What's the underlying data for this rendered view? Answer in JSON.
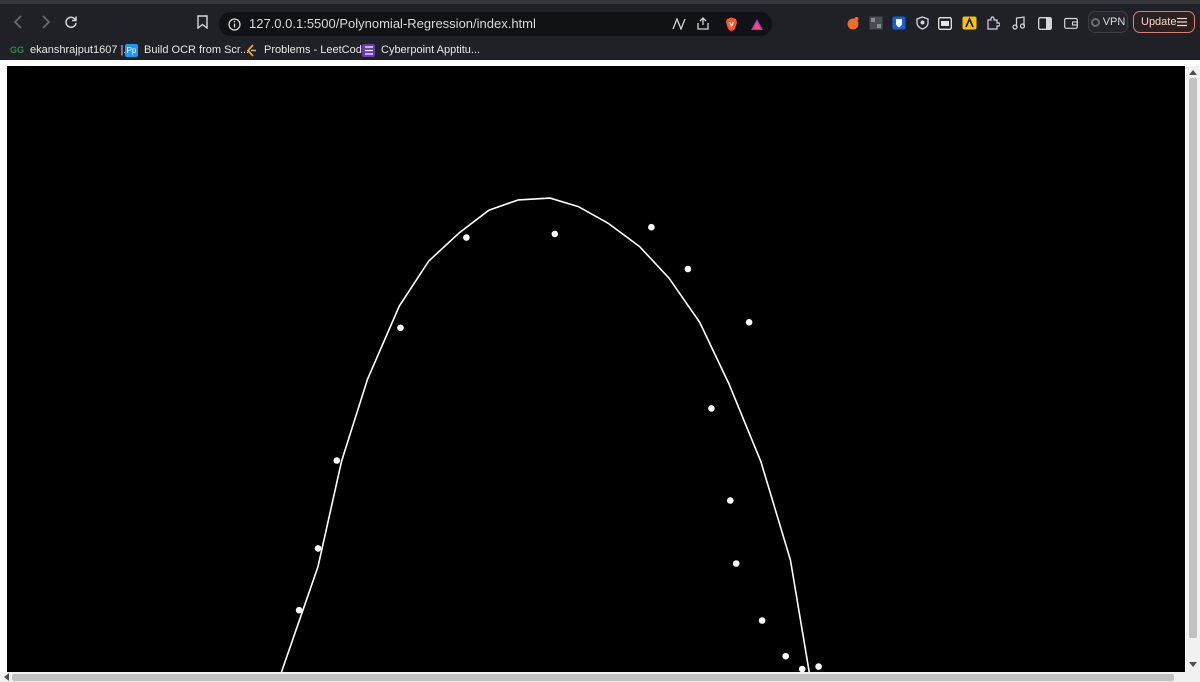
{
  "browser": {
    "url": "127.0.0.1:5500/Polynomial-Regression/index.html",
    "vpn_label": "VPN",
    "update_label": "Update"
  },
  "bookmarks": [
    {
      "label": "ekanshrajput1607 |...",
      "icon": "gfg-icon",
      "color": "#2f8d46"
    },
    {
      "label": "Build OCR from Scr...",
      "icon": "pp-icon",
      "color": "#2196f3"
    },
    {
      "label": "Problems - LeetCode",
      "icon": "leetcode-icon",
      "color": "#f0a22e"
    },
    {
      "label": "Cyberpoint Apptitu...",
      "icon": "forms-icon",
      "color": "#673ab7"
    }
  ],
  "canvas": {
    "background": "#000000",
    "curve_color": "#ffffff",
    "point_color": "#ffffff"
  },
  "chart_data": {
    "type": "scatter",
    "title": "",
    "xlabel": "",
    "ylabel": "",
    "xlim": [
      0,
      1
    ],
    "ylim": [
      0,
      1
    ],
    "grid": false,
    "points": [
      [
        0.248,
        0.102
      ],
      [
        0.264,
        0.204
      ],
      [
        0.28,
        0.349
      ],
      [
        0.334,
        0.568
      ],
      [
        0.39,
        0.717
      ],
      [
        0.465,
        0.723
      ],
      [
        0.547,
        0.734
      ],
      [
        0.63,
        0.577
      ],
      [
        0.578,
        0.665
      ],
      [
        0.598,
        0.435
      ],
      [
        0.614,
        0.283
      ],
      [
        0.619,
        0.179
      ],
      [
        0.641,
        0.085
      ],
      [
        0.661,
        0.026
      ],
      [
        0.675,
        0.005
      ],
      [
        0.689,
        0.009
      ]
    ],
    "curve": [
      [
        0.233,
        0.0
      ],
      [
        0.264,
        0.174
      ],
      [
        0.284,
        0.348
      ],
      [
        0.306,
        0.483
      ],
      [
        0.333,
        0.604
      ],
      [
        0.358,
        0.678
      ],
      [
        0.384,
        0.725
      ],
      [
        0.409,
        0.762
      ],
      [
        0.434,
        0.779
      ],
      [
        0.461,
        0.782
      ],
      [
        0.485,
        0.768
      ],
      [
        0.51,
        0.741
      ],
      [
        0.537,
        0.702
      ],
      [
        0.562,
        0.65
      ],
      [
        0.588,
        0.577
      ],
      [
        0.613,
        0.475
      ],
      [
        0.64,
        0.347
      ],
      [
        0.665,
        0.185
      ],
      [
        0.681,
        0.0
      ]
    ]
  }
}
